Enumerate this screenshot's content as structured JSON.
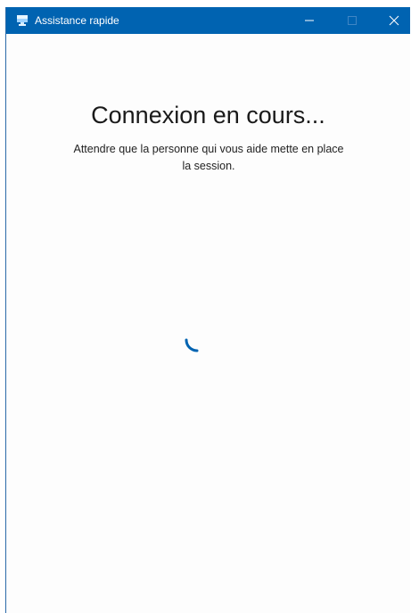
{
  "window": {
    "title": "Assistance rapide",
    "app_icon": "quick-assist-icon",
    "controls": {
      "minimize_icon": "minimize-icon",
      "maximize_icon": "maximize-icon",
      "close_icon": "close-icon"
    }
  },
  "main": {
    "heading": "Connexion en cours...",
    "message": "Attendre que la personne qui vous aide mette en place la session.",
    "loading_icon": "spinner-icon"
  },
  "colors": {
    "titlebar": "#0063b1",
    "accent": "#0063b1",
    "background": "#fdfdfd"
  }
}
